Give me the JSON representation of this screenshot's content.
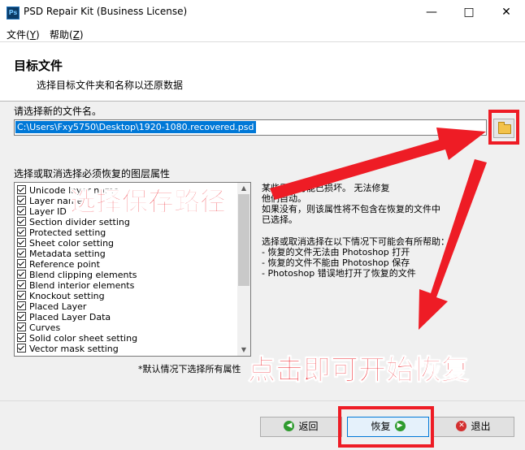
{
  "window": {
    "title": "PSD Repair Kit (Business License)",
    "icon_text": "Ps"
  },
  "menu": [
    {
      "label": "文件(",
      "key": "Y",
      "suffix": ")"
    },
    {
      "label": "帮助(",
      "key": "Z",
      "suffix": ")"
    }
  ],
  "header": {
    "title": "目标文件",
    "subtitle": "选择目标文件夹和名称以还原数据"
  },
  "file": {
    "label": "请选择新的文件名。",
    "value": "C:\\Users\\Fxy5750\\Desktop\\1920-1080.recovered.psd"
  },
  "attributes": {
    "label": "选择或取消选择必须恢复的图层属性",
    "items": [
      "Unicode layer name",
      "Layer name",
      "Layer ID",
      "Section divider setting",
      "Protected setting",
      "Sheet color setting",
      "Metadata setting",
      "Reference point",
      "Blend clipping elements",
      "Blend interior elements",
      "Knockout setting",
      "Placed Layer",
      "Placed Layer Data",
      "Curves",
      "Solid color sheet setting",
      "Vector mask setting"
    ]
  },
  "info": {
    "paragraph1": "某些属性可能已损坏。 无法修复\n他们自动。\n如果没有，则该属性将不包含在恢复的文件中\n已选择。",
    "paragraph2": "选择或取消选择在以下情况下可能会有所帮助：\n- 恢复的文件无法由 Photoshop 打开\n- 恢复的文件不能由 Photoshop 保存\n- Photoshop 错误地打开了恢复的文件"
  },
  "default_note": "*默认情况下选择所有属性",
  "buttons": {
    "back": "返回",
    "recover": "恢复",
    "exit": "退出"
  },
  "annotations": {
    "choose_path": "选择保存路径",
    "click_recover": "点击即可开始恢复"
  },
  "colors": {
    "accent": "#ee1c25",
    "selection": "#0078d7",
    "back_icon": "#2e9b2e",
    "exit_icon": "#d32f2f"
  }
}
